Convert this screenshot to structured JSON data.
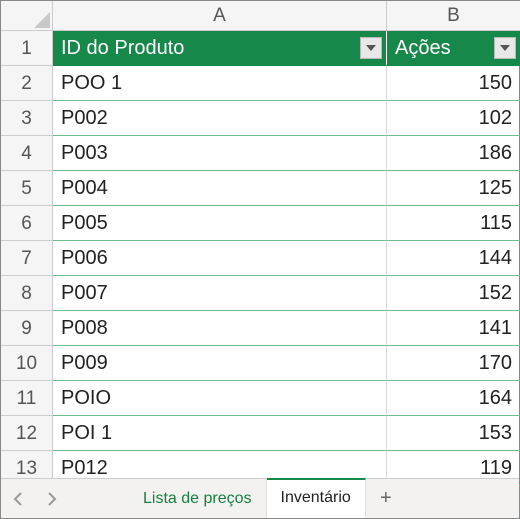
{
  "columns": {
    "A": "A",
    "B": "B"
  },
  "header": {
    "colA": "ID do Produto",
    "colB": "Ações"
  },
  "rowNums": [
    "1",
    "2",
    "3",
    "4",
    "5",
    "6",
    "7",
    "8",
    "9",
    "10",
    "11",
    "12",
    "13"
  ],
  "rows": [
    {
      "id": "POO 1",
      "val": "150"
    },
    {
      "id": "P002",
      "val": "102"
    },
    {
      "id": "P003",
      "val": "186"
    },
    {
      "id": "P004",
      "val": "125"
    },
    {
      "id": "P005",
      "val": "115"
    },
    {
      "id": "P006",
      "val": "144"
    },
    {
      "id": "P007",
      "val": "152"
    },
    {
      "id": "P008",
      "val": "141"
    },
    {
      "id": "P009",
      "val": "170"
    },
    {
      "id": "POIO",
      "val": "164"
    },
    {
      "id": "POI 1",
      "val": "153"
    },
    {
      "id": "P012",
      "val": "119"
    }
  ],
  "tabs": {
    "prev": "‹",
    "next": "›",
    "sheet1": "Lista de preços",
    "sheet2": "Inventário",
    "add": "+"
  },
  "chart_data": {
    "type": "table",
    "columns": [
      "ID do Produto",
      "Ações"
    ],
    "rows": [
      [
        "POO 1",
        150
      ],
      [
        "P002",
        102
      ],
      [
        "P003",
        186
      ],
      [
        "P004",
        125
      ],
      [
        "P005",
        115
      ],
      [
        "P006",
        144
      ],
      [
        "P007",
        152
      ],
      [
        "P008",
        141
      ],
      [
        "P009",
        170
      ],
      [
        "POIO",
        164
      ],
      [
        "POI 1",
        153
      ],
      [
        "P012",
        119
      ]
    ]
  }
}
